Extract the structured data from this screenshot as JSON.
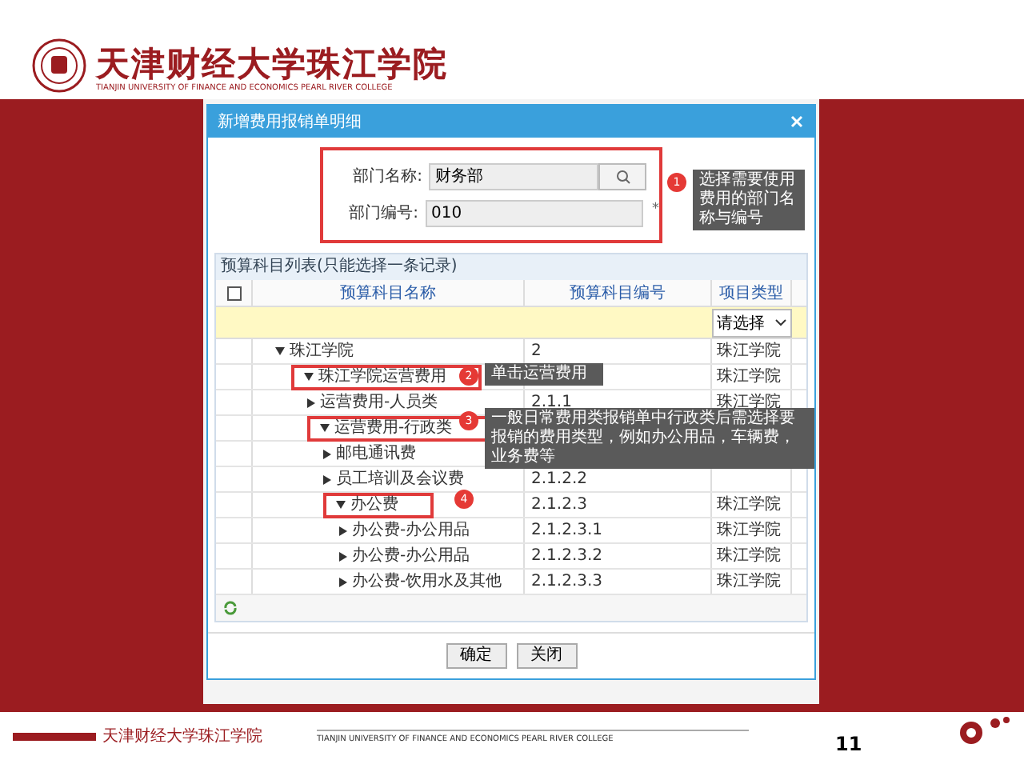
{
  "header": {
    "logo_title": "天津财经大学珠江学院",
    "logo_subtitle": "TIANJIN UNIVERSITY OF FINANCE AND ECONOMICS PEARL RIVER COLLEGE"
  },
  "dialog": {
    "title": "新增费用报销单明细",
    "fields": [
      {
        "kind": "lookup",
        "label": "部门名称:",
        "value": "财务部"
      },
      {
        "kind": "text",
        "label": "部门编号:",
        "value": "010",
        "required_mark": "*"
      }
    ],
    "fields_highlighted": true,
    "select_all": {
      "checked": false
    },
    "section_title": "预算科目列表(只能选择一条记录)",
    "columns": [
      "预算科目名称",
      "预算科目编号",
      "项目类型"
    ],
    "filter": {
      "value": "请选择"
    },
    "rows": [
      {
        "name": "珠江学院",
        "code": "2",
        "type": "珠江学院",
        "expanded": true,
        "highlighted": false,
        "children": [
          {
            "name": "珠江学院运营费用",
            "type": "珠江学院",
            "expanded": true,
            "highlighted": true,
            "children": [
              {
                "name": "运营费用-人员类",
                "code": "2.1.1",
                "type": "珠江学院",
                "expanded": false,
                "highlighted": false
              },
              {
                "name": "运营费用-行政类",
                "expanded": true,
                "highlighted": true,
                "children": [
                  {
                    "name": "邮电通讯费",
                    "expanded": false,
                    "highlighted": false
                  },
                  {
                    "name": "员工培训及会议费",
                    "code": "2.1.2.2",
                    "expanded": false,
                    "highlighted": false
                  },
                  {
                    "name": "办公费",
                    "code": "2.1.2.3",
                    "type": "珠江学院",
                    "expanded": true,
                    "highlighted": true,
                    "children": [
                      {
                        "name": "办公费-办公用品",
                        "code": "2.1.2.3.1",
                        "type": "珠江学院",
                        "expanded": false,
                        "highlighted": false
                      },
                      {
                        "name": "办公费-办公用品",
                        "code": "2.1.2.3.2",
                        "type": "珠江学院",
                        "expanded": false,
                        "highlighted": false
                      },
                      {
                        "name": "办公费-饮用水及其他",
                        "code": "2.1.2.3.3",
                        "type": "珠江学院",
                        "expanded": false,
                        "highlighted": false
                      }
                    ]
                  }
                ]
              }
            ]
          }
        ]
      }
    ],
    "buttons": [
      "确定",
      "关闭"
    ]
  },
  "callouts": [
    {
      "number": "1",
      "text": "选择需要使用费用的部门名称与编号"
    },
    {
      "number": "2",
      "text": "单击运营费用"
    },
    {
      "number": "3",
      "text": "一般日常费用类报销单中行政类后需选择要报销的费用类型，例如办公用品，车辆费，业务费等"
    },
    {
      "number": "4"
    }
  ],
  "footer": {
    "college": "天津财经大学珠江学院",
    "english": "TIANJIN UNIVERSITY OF FINANCE AND ECONOMICS PEARL RIVER COLLEGE",
    "page": "11"
  }
}
